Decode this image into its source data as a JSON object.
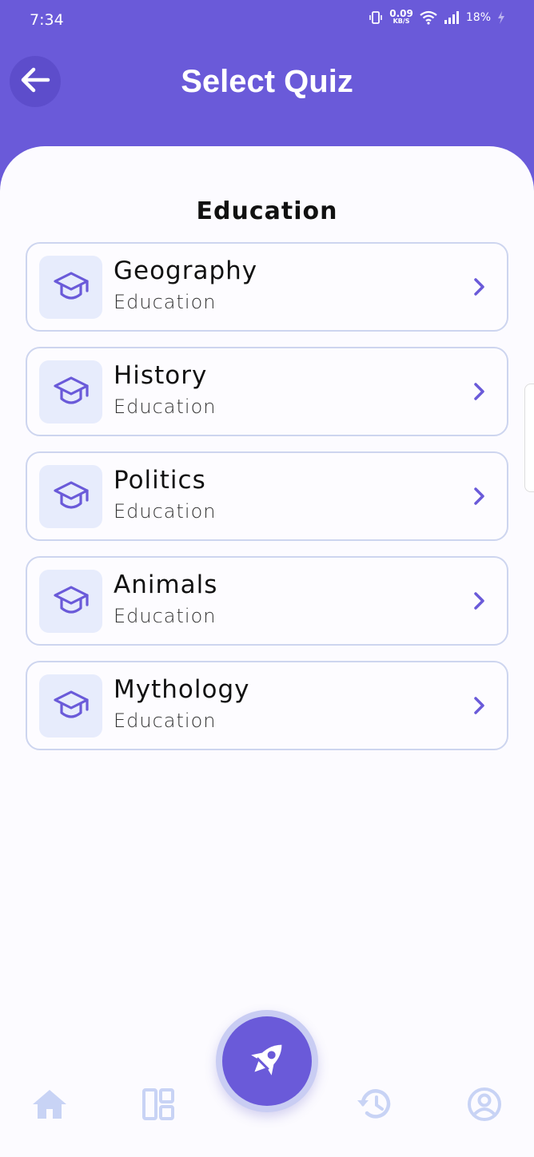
{
  "status_bar": {
    "time": "7:34",
    "net_speed": "0.09",
    "net_unit": "KB/S",
    "battery": "18%"
  },
  "header": {
    "title": "Select Quiz"
  },
  "section": {
    "title": "Education"
  },
  "quizzes": [
    {
      "name": "Geography",
      "category": "Education"
    },
    {
      "name": "History",
      "category": "Education"
    },
    {
      "name": "Politics",
      "category": "Education"
    },
    {
      "name": "Animals",
      "category": "Education"
    },
    {
      "name": "Mythology",
      "category": "Education"
    }
  ],
  "bottom_nav": {
    "items": [
      {
        "icon": "home-icon"
      },
      {
        "icon": "dashboard-icon"
      },
      {
        "icon": "rocket-icon"
      },
      {
        "icon": "history-icon"
      },
      {
        "icon": "profile-icon"
      }
    ]
  },
  "colors": {
    "primary": "#6A5AD9",
    "card_border": "#CDD5EF",
    "icon_bg": "#E7ECFC",
    "nav_inactive": "#C8D3F5"
  }
}
